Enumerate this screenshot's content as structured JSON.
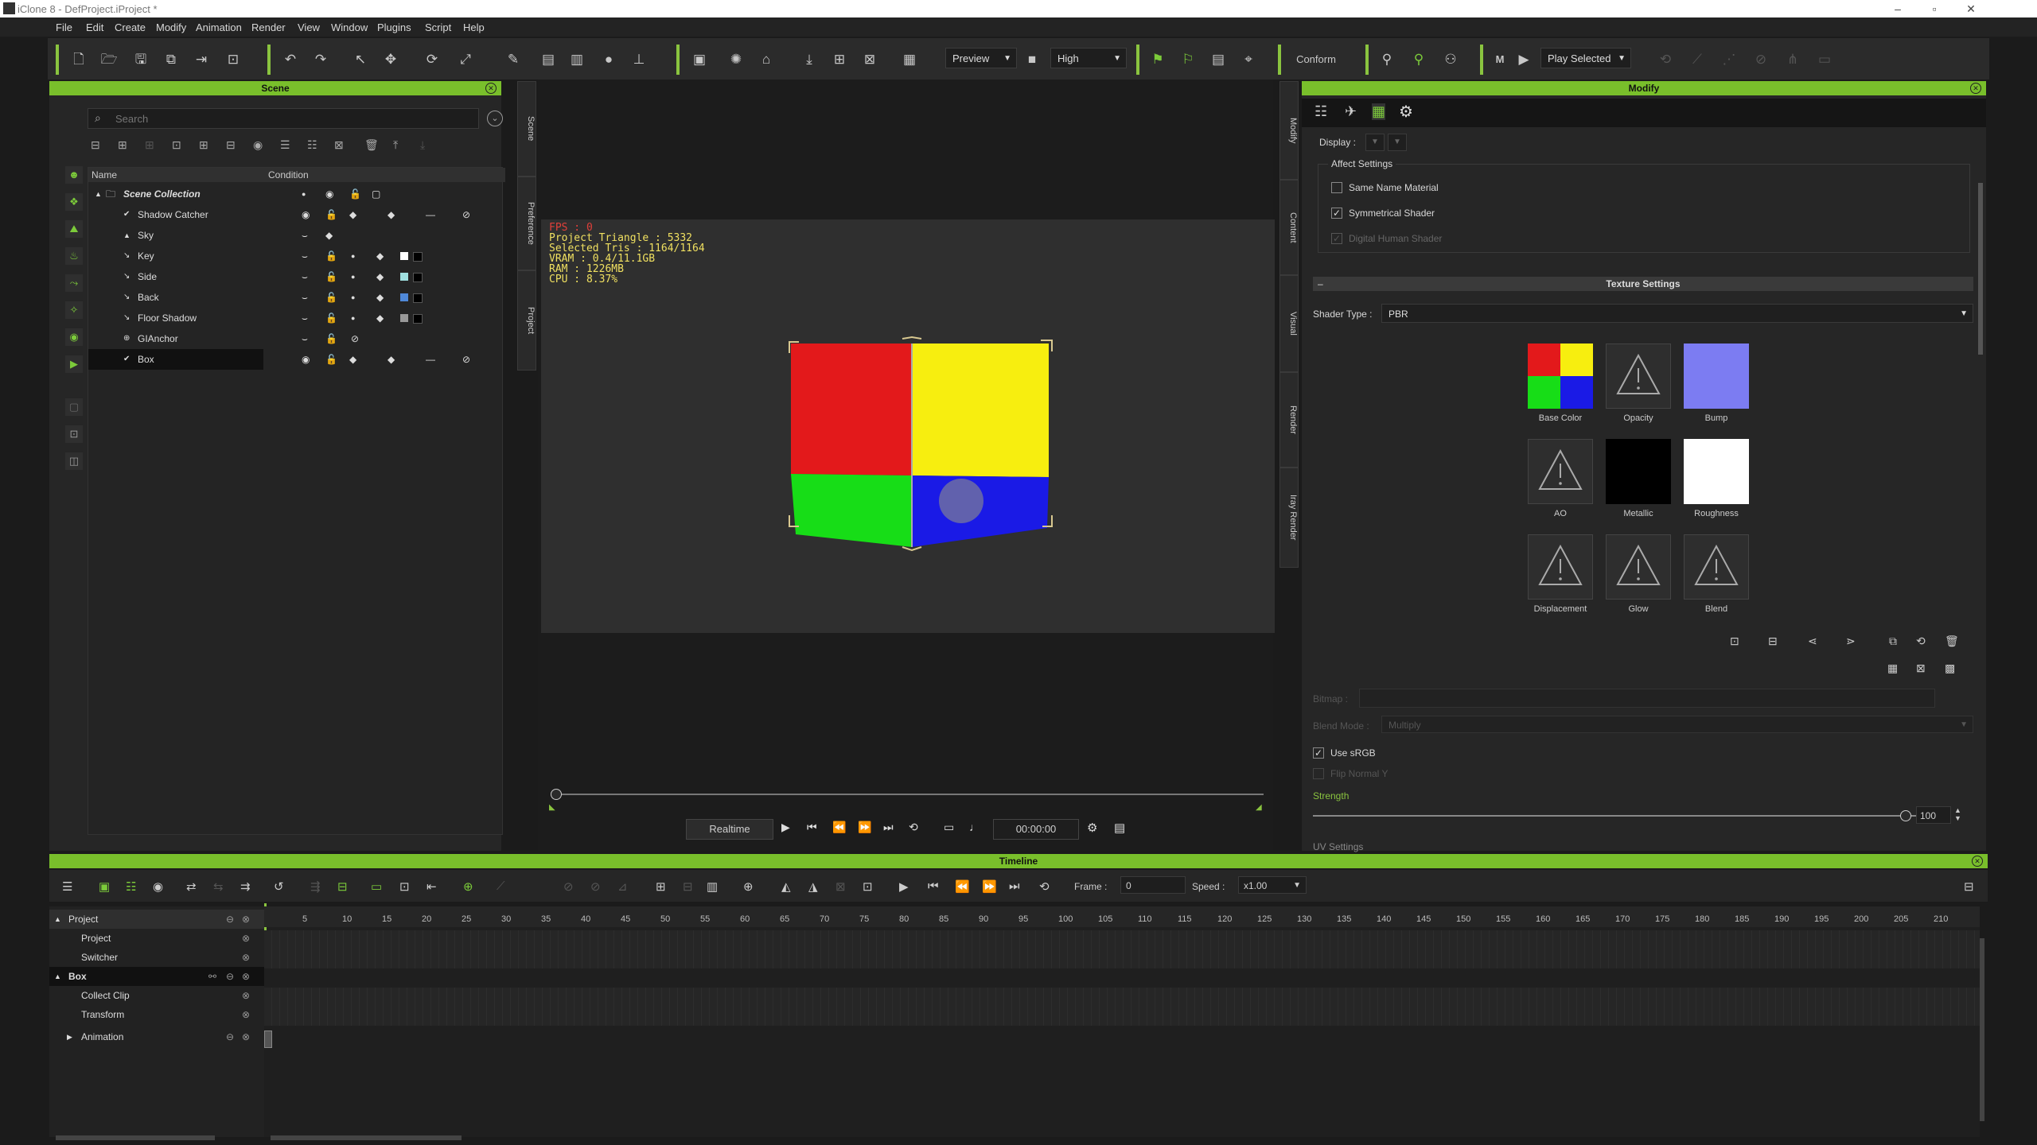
{
  "window": {
    "title": "iClone 8 - DefProject.iProject *"
  },
  "menu": [
    "File",
    "Edit",
    "Create",
    "Modify",
    "Animation",
    "Render",
    "View",
    "Window",
    "Plugins",
    "Script",
    "Help"
  ],
  "toolbar": {
    "preview_label": "Preview",
    "quality_label": "High",
    "conform_label": "Conform",
    "play_selected_label": "Play Selected"
  },
  "scene": {
    "title": "Scene",
    "search_placeholder": "Search",
    "col_name": "Name",
    "col_condition": "Condition",
    "items": [
      {
        "label": "Scene Collection"
      },
      {
        "label": "Shadow Catcher"
      },
      {
        "label": "Sky"
      },
      {
        "label": "Key"
      },
      {
        "label": "Side"
      },
      {
        "label": "Back"
      },
      {
        "label": "Floor Shadow"
      },
      {
        "label": "GIAnchor"
      },
      {
        "label": "Box"
      }
    ],
    "side_tabs": [
      "Scene",
      "Preference",
      "Project"
    ]
  },
  "viewport": {
    "stats": [
      "FPS : 0",
      "Project Triangle : 5332",
      "Selected Tris : 1164/1164",
      "VRAM : 0.4/11.1GB",
      "RAM : 1226MB",
      "CPU : 8.37%"
    ],
    "realtime_label": "Realtime",
    "timecode": "00:00:00",
    "cube_colors": {
      "red": "#e3191b",
      "yellow": "#f7ee0f",
      "green": "#17dd17",
      "blue": "#1a1ae6"
    }
  },
  "modify": {
    "title": "Modify",
    "display_label": "Display :",
    "affect_settings": "Affect Settings",
    "same_name_material": "Same Name Material",
    "symmetrical_shader": "Symmetrical Shader",
    "digital_human_shader": "Digital Human Shader",
    "texture_settings": "Texture Settings",
    "shader_type_label": "Shader Type :",
    "shader_type_value": "PBR",
    "textures": [
      {
        "label": "Base Color"
      },
      {
        "label": "Opacity"
      },
      {
        "label": "Bump"
      },
      {
        "label": "AO"
      },
      {
        "label": "Metallic"
      },
      {
        "label": "Roughness"
      },
      {
        "label": "Displacement"
      },
      {
        "label": "Glow"
      },
      {
        "label": "Blend"
      }
    ],
    "bitmap_label": "Bitmap :",
    "blend_mode_label": "Blend Mode :",
    "blend_mode_value": "Multiply",
    "use_srgb": "Use sRGB",
    "flip_normal": "Flip Normal Y",
    "strength_label": "Strength",
    "strength_value": "100",
    "uv_settings": "UV Settings",
    "side_tabs": [
      "Modify",
      "Content",
      "Visual",
      "Render",
      "Iray Render"
    ]
  },
  "timeline": {
    "title": "Timeline",
    "frame_label": "Frame :",
    "frame_value": "0",
    "speed_label": "Speed :",
    "speed_value": "x1.00",
    "ruler": [
      "5",
      "10",
      "15",
      "20",
      "25",
      "30",
      "35",
      "40",
      "45",
      "50",
      "55",
      "60",
      "65",
      "70",
      "75",
      "80",
      "85",
      "90",
      "95",
      "100",
      "105",
      "110",
      "115",
      "120",
      "125",
      "130",
      "135",
      "140",
      "145",
      "150",
      "155",
      "160",
      "165",
      "170",
      "175",
      "180",
      "185",
      "190",
      "195",
      "200",
      "205",
      "210"
    ],
    "tracks": [
      {
        "label": "Project"
      },
      {
        "label": "Project"
      },
      {
        "label": "Switcher"
      },
      {
        "label": "Box"
      },
      {
        "label": "Collect Clip"
      },
      {
        "label": "Transform"
      },
      {
        "label": "Animation"
      }
    ]
  }
}
